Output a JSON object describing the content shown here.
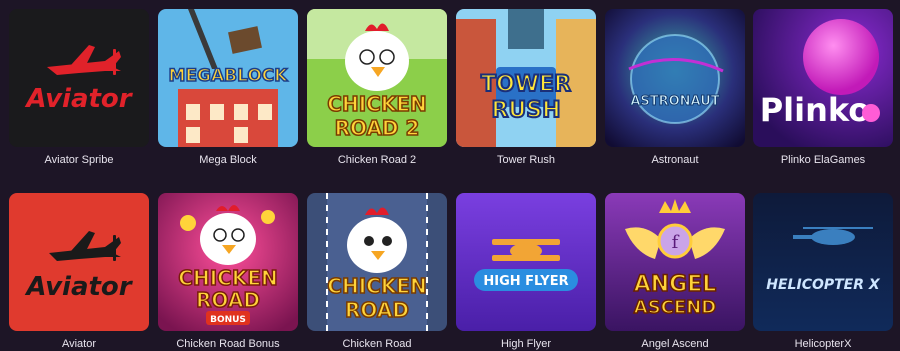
{
  "games": [
    {
      "title": "Aviator Spribe",
      "logo": "Aviator",
      "icon": "plane-icon"
    },
    {
      "title": "Mega Block",
      "logo": "MEGABLOCK",
      "icon": "crane-building-icon"
    },
    {
      "title": "Chicken Road 2",
      "logo_line1": "CHICKEN",
      "logo_line2": "ROAD 2",
      "icon": "chicken-icon"
    },
    {
      "title": "Tower Rush",
      "logo_line1": "TOWER",
      "logo_line2": "RUSH",
      "icon": "tower-icon"
    },
    {
      "title": "Astronaut",
      "logo": "ASTRONAUT",
      "icon": "planet-icon"
    },
    {
      "title": "Plinko ElaGames",
      "logo": "Plinko",
      "icon": "ball-icon"
    },
    {
      "title": "Aviator",
      "logo": "Aviator",
      "icon": "plane-icon"
    },
    {
      "title": "Chicken Road Bonus",
      "logo_line1": "CHICKEN",
      "logo_line2": "ROAD",
      "badge": "BONUS",
      "icon": "chicken-icon"
    },
    {
      "title": "Chicken Road",
      "logo_line1": "CHICKEN",
      "logo_line2": "ROAD",
      "icon": "chicken-icon"
    },
    {
      "title": "High Flyer",
      "logo": "HIGH FLYER",
      "icon": "biplane-icon"
    },
    {
      "title": "Angel Ascend",
      "logo_line1": "ANGEL",
      "logo_line2": "ASCEND",
      "emblem": "f",
      "icon": "crown-wings-icon"
    },
    {
      "title": "HelicopterX",
      "logo": "HELICOPTER X",
      "icon": "helicopter-icon"
    }
  ]
}
